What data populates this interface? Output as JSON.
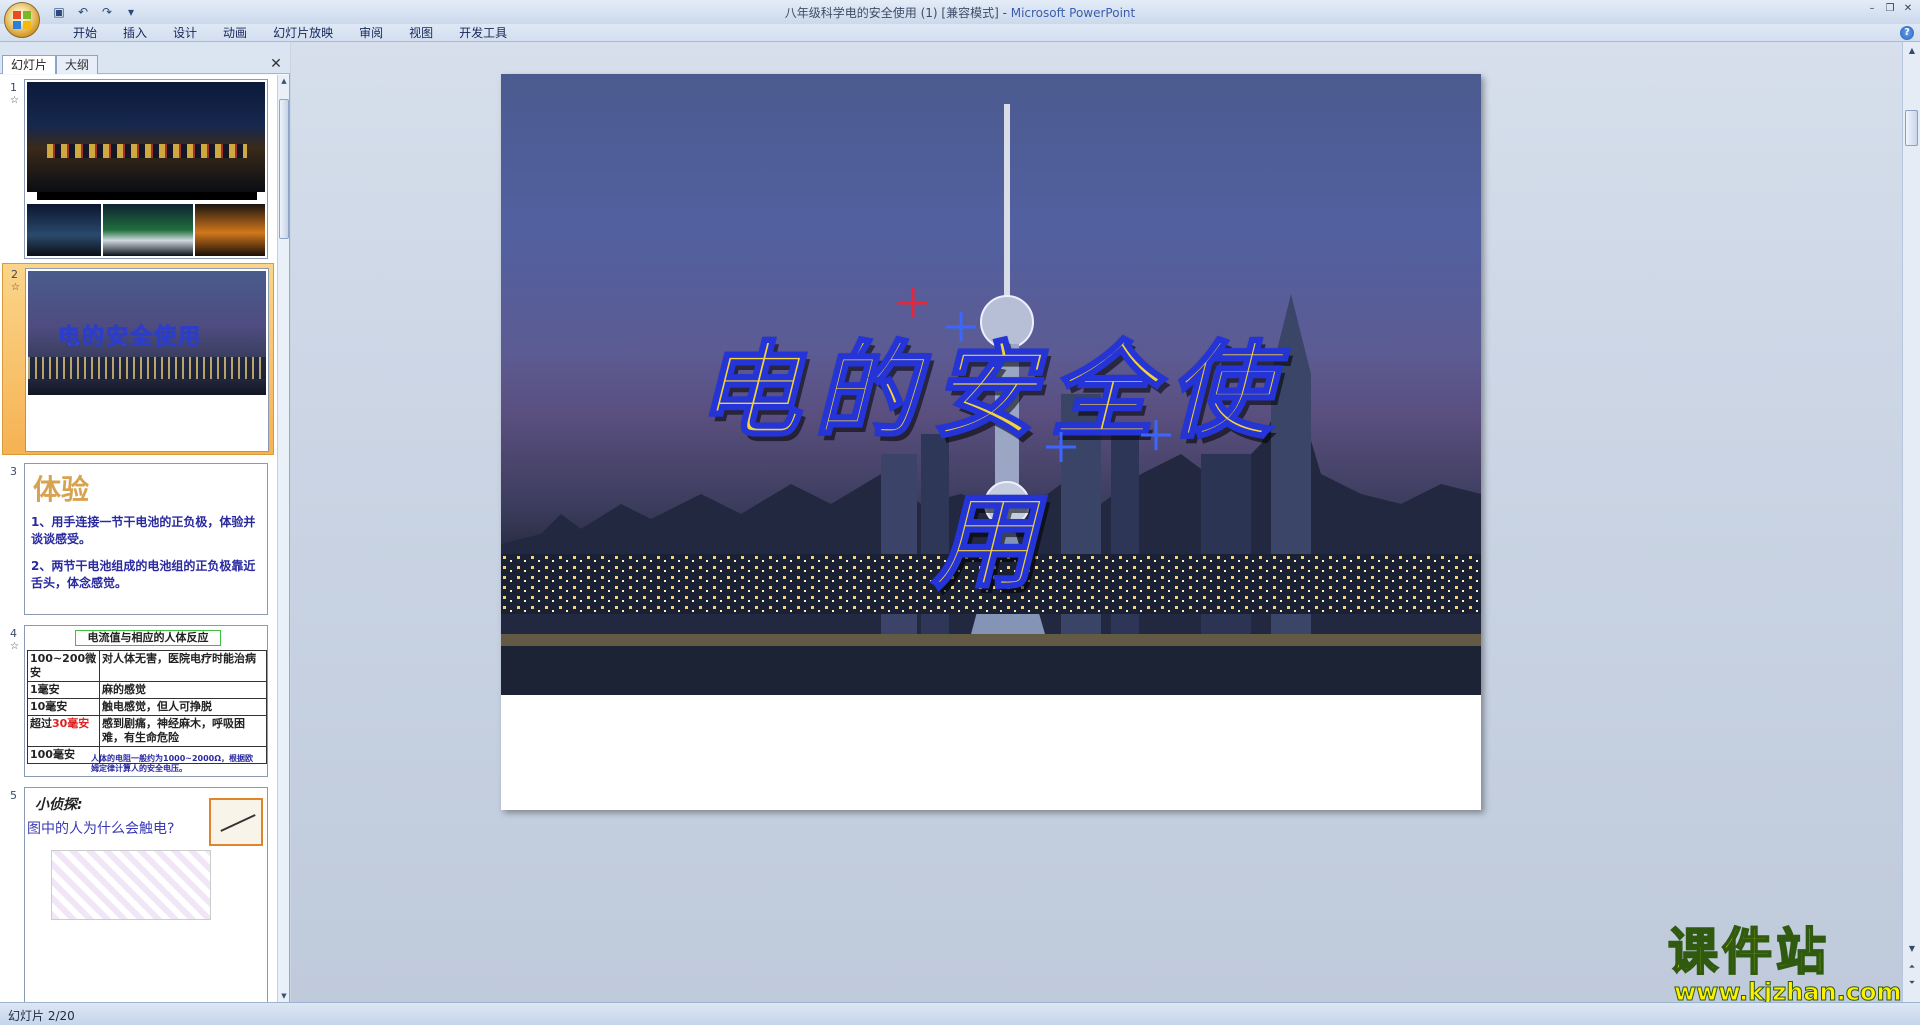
{
  "window": {
    "title": "八年级科学电的安全使用 (1) [兼容模式] - ",
    "app_name": "Microsoft PowerPoint"
  },
  "ribbon": {
    "tabs": [
      "开始",
      "插入",
      "设计",
      "动画",
      "幻灯片放映",
      "审阅",
      "视图",
      "开发工具"
    ]
  },
  "left_panel": {
    "tabs": [
      {
        "label": "幻灯片",
        "active": true
      },
      {
        "label": "大纲",
        "active": false
      }
    ],
    "slides": [
      {
        "number": "1",
        "marker": "☆"
      },
      {
        "number": "2",
        "marker": "☆",
        "selected": true,
        "title": "电的安全使用"
      },
      {
        "number": "3",
        "marker": "",
        "heading": "体验",
        "items": [
          "1、用手连接一节干电池的正负极，体验并谈谈感受。",
          "2、两节干电池组成的电池组的正负极靠近舌头，体念感觉。"
        ]
      },
      {
        "number": "4",
        "marker": "☆",
        "heading": "电流值与相应的人体反应",
        "rows": [
          {
            "current": "100~200微安",
            "reaction": "对人体无害，医院电疗时能治病"
          },
          {
            "current": "1毫安",
            "reaction": "麻的感觉"
          },
          {
            "current": "10毫安",
            "reaction": "触电感觉，但人可挣脱"
          },
          {
            "current_prefix": "超过",
            "current_highlight": "30毫安",
            "reaction": "感到剧痛，神经麻木，呼吸困难，有生命危险"
          },
          {
            "current": "100毫安",
            "reaction": ""
          }
        ],
        "note": "人体的电阻一般约为1000~2000Ω，根据欧姆定律计算人的安全电压。"
      },
      {
        "number": "5",
        "marker": "",
        "label": "小侦探:",
        "question": "图中的人为什么会触电?"
      }
    ]
  },
  "slide": {
    "title": "电的安全使用"
  },
  "watermark": {
    "brand": "课件站",
    "url": "www.kjzhan.com"
  },
  "status": {
    "slide_indicator": "幻灯片 2/20"
  },
  "colors": {
    "title_fill": "#f3d23a",
    "title_outline": "#2434d6",
    "selected_thumb": "#f6b253"
  }
}
